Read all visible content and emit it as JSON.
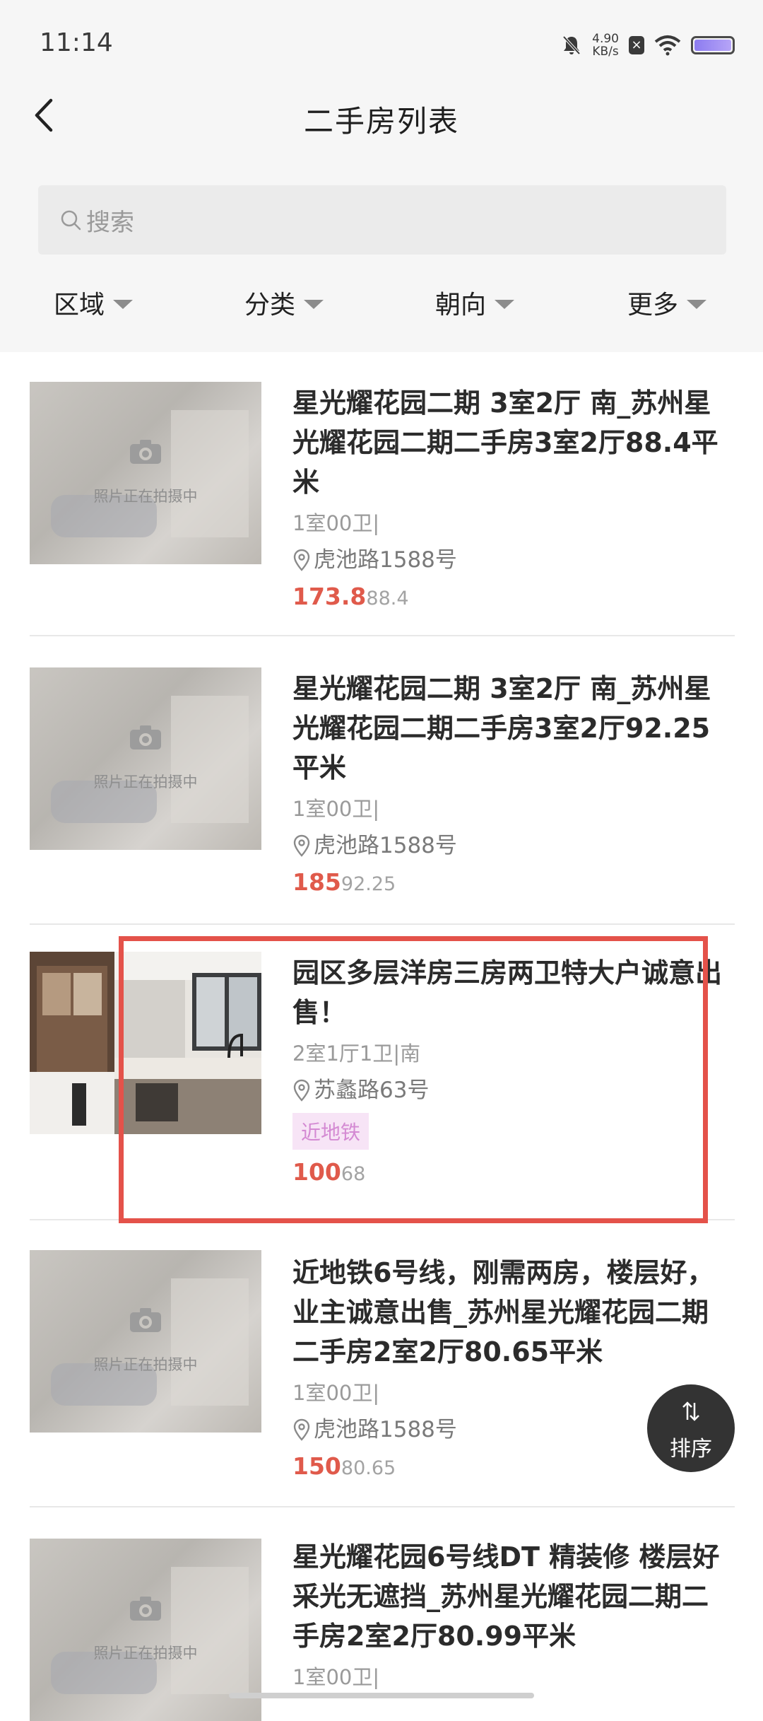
{
  "status_bar": {
    "time": "11:14",
    "speed_value": "4.90",
    "speed_unit": "KB/s"
  },
  "header": {
    "title": "二手房列表"
  },
  "search": {
    "placeholder": "搜索"
  },
  "filters": [
    "区域",
    "分类",
    "朝向",
    "更多"
  ],
  "listings": [
    {
      "title": "星光耀花园二期 3室2厅 南_苏州星光耀花园二期二手房3室2厅88.4平米",
      "meta": "1室00卫|",
      "address": "虎池路1588号",
      "price": "173.8",
      "area": "88.4",
      "photo_caption": "照片正在拍摄中"
    },
    {
      "title": "星光耀花园二期 3室2厅 南_苏州星光耀花园二期二手房3室2厅92.25平米",
      "meta": "1室00卫|",
      "address": "虎池路1588号",
      "price": "185",
      "area": "92.25",
      "photo_caption": "照片正在拍摄中"
    },
    {
      "title": "园区多层洋房三房两卫特大户诚意出售！",
      "meta": "2室1厅1卫|南",
      "address": "苏蠡路63号",
      "tag": "近地铁",
      "price": "100",
      "area": "68"
    },
    {
      "title": "近地铁6号线，刚需两房，楼层好，业主诚意出售_苏州星光耀花园二期二手房2室2厅80.65平米",
      "meta": "1室00卫|",
      "address": "虎池路1588号",
      "price": "150",
      "area": "80.65",
      "photo_caption": "照片正在拍摄中"
    },
    {
      "title": "星光耀花园6号线DT 精装修 楼层好采光无遮挡_苏州星光耀花园二期二手房2室2厅80.99平米",
      "meta": "1室00卫|",
      "photo_caption": "照片正在拍摄中"
    }
  ],
  "sort_button": {
    "label": "排序"
  },
  "colors": {
    "price": "#e05a4b",
    "highlight": "#e4524a",
    "tag_bg": "#f7e4f6",
    "tag_text": "#d48ad3"
  },
  "icons": [
    "back-arrow-icon",
    "search-icon",
    "caret-down-icon",
    "camera-icon",
    "location-pin-icon",
    "sort-arrows-icon"
  ]
}
